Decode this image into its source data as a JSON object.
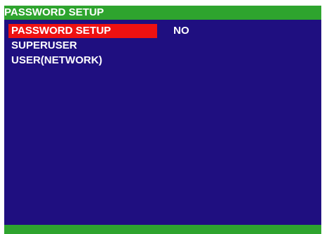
{
  "window": {
    "title": "PASSWORD SETUP"
  },
  "menu": {
    "items": [
      {
        "label": "PASSWORD SETUP",
        "value": "NO",
        "selected": true
      },
      {
        "label": "SUPERUSER",
        "value": "",
        "selected": false
      },
      {
        "label": "USER(NETWORK)",
        "value": "",
        "selected": false
      }
    ]
  },
  "colors": {
    "background": "#1f0f80",
    "title_bar": "#2ea42e",
    "footer_bar": "#2ea42e",
    "selection": "#ee1111",
    "text": "#ffffff"
  }
}
